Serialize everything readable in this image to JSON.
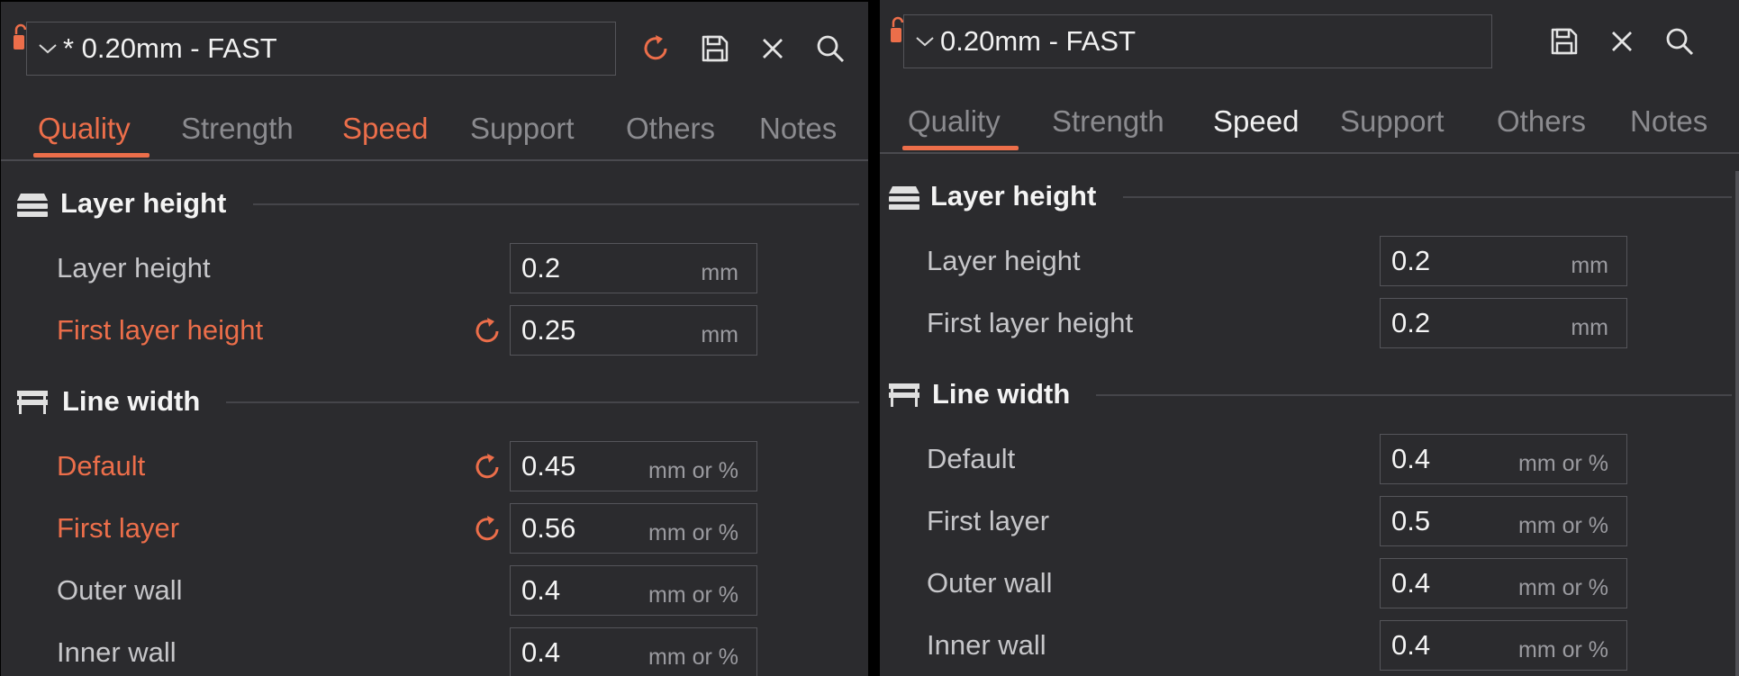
{
  "colors": {
    "accent": "#ec6e4a",
    "panel_bg": "#2b2b2e",
    "text": "#f1f1f1",
    "muted": "#8b8b8f"
  },
  "left": {
    "preset": {
      "name": "* 0.20mm - FAST"
    },
    "toolbar": {
      "reset_icon": "reset-icon",
      "save_icon": "save-icon",
      "close_icon": "close-icon",
      "search_icon": "search-icon"
    },
    "tabs": [
      {
        "label": "Quality",
        "active": true
      },
      {
        "label": "Strength"
      },
      {
        "label": "Speed",
        "modified": true
      },
      {
        "label": "Support"
      },
      {
        "label": "Others"
      },
      {
        "label": "Notes"
      }
    ],
    "sections": {
      "layer_height": {
        "title": "Layer height",
        "rows": [
          {
            "label": "Layer height",
            "value": "0.2",
            "unit": "mm"
          },
          {
            "label": "First layer height",
            "value": "0.25",
            "unit": "mm",
            "modified": true
          }
        ]
      },
      "line_width": {
        "title": "Line width",
        "rows": [
          {
            "label": "Default",
            "value": "0.45",
            "unit": "mm or %",
            "modified": true
          },
          {
            "label": "First layer",
            "value": "0.56",
            "unit": "mm or %",
            "modified": true
          },
          {
            "label": "Outer wall",
            "value": "0.4",
            "unit": "mm or %"
          },
          {
            "label": "Inner wall",
            "value": "0.4",
            "unit": "mm or %"
          }
        ]
      }
    }
  },
  "right": {
    "preset": {
      "name": "0.20mm - FAST"
    },
    "toolbar": {
      "save_icon": "save-icon",
      "close_icon": "close-icon",
      "search_icon": "search-icon"
    },
    "tabs": [
      {
        "label": "Quality",
        "active": true
      },
      {
        "label": "Strength"
      },
      {
        "label": "Speed"
      },
      {
        "label": "Support"
      },
      {
        "label": "Others"
      },
      {
        "label": "Notes"
      }
    ],
    "sections": {
      "layer_height": {
        "title": "Layer height",
        "rows": [
          {
            "label": "Layer height",
            "value": "0.2",
            "unit": "mm"
          },
          {
            "label": "First layer height",
            "value": "0.2",
            "unit": "mm"
          }
        ]
      },
      "line_width": {
        "title": "Line width",
        "rows": [
          {
            "label": "Default",
            "value": "0.4",
            "unit": "mm or %"
          },
          {
            "label": "First layer",
            "value": "0.5",
            "unit": "mm or %"
          },
          {
            "label": "Outer wall",
            "value": "0.4",
            "unit": "mm or %"
          },
          {
            "label": "Inner wall",
            "value": "0.4",
            "unit": "mm or %"
          }
        ]
      }
    }
  }
}
